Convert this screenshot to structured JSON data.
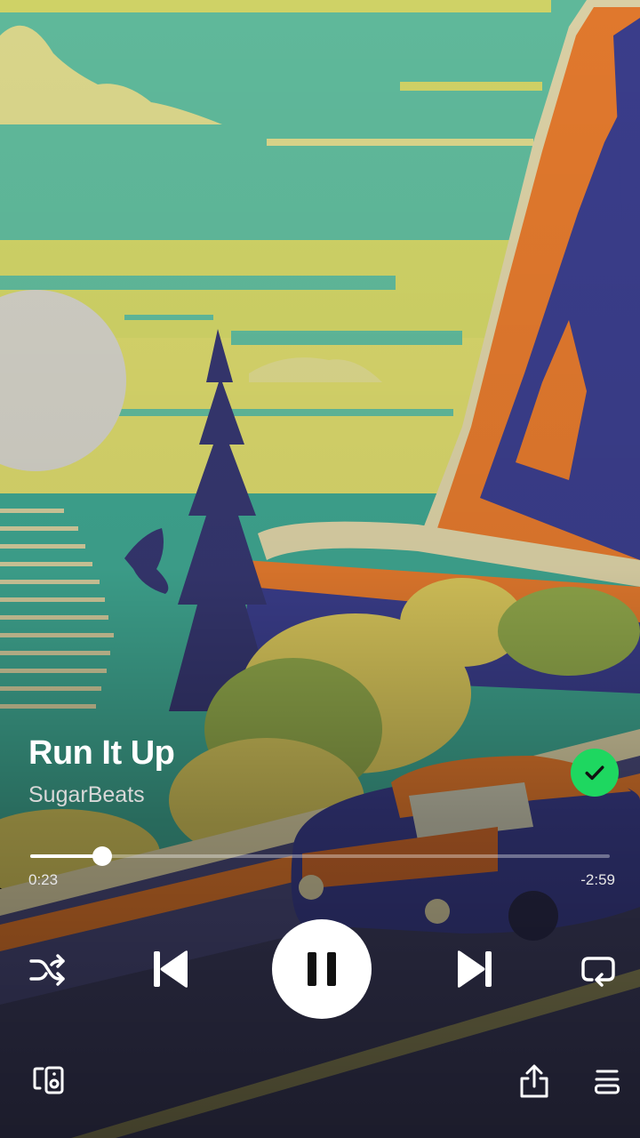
{
  "track": {
    "title": "Run It Up",
    "artist": "SugarBeats",
    "liked": true
  },
  "playback": {
    "elapsed": "0:23",
    "remaining": "-2:59",
    "progress_fraction": 0.124,
    "state": "playing"
  },
  "icons": {
    "liked": "check-circle-icon",
    "shuffle": "shuffle-icon",
    "previous": "skip-previous-icon",
    "pause": "pause-icon",
    "next": "skip-next-icon",
    "repeat": "repeat-icon",
    "devices": "connect-device-icon",
    "share": "share-icon",
    "queue": "queue-icon"
  },
  "colors": {
    "accent": "#1ed760",
    "text_primary": "#ffffff",
    "text_secondary": "#d8d8d8"
  }
}
